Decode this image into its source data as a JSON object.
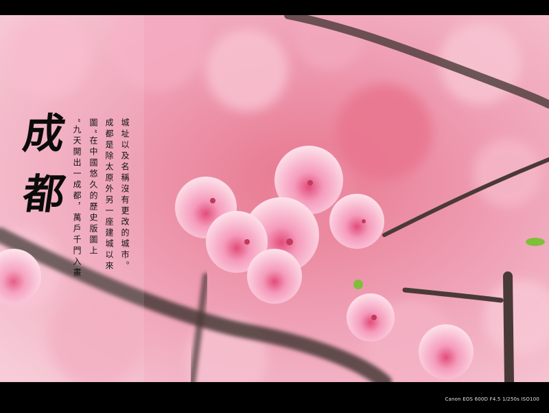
{
  "poem": {
    "title_char_1": "成",
    "title_char_2": "都",
    "lines": [
      "“九天開出一成都，萬戶千門入畫",
      "圖”在中國悠久的歷史版圖上",
      "成都是除太原外另一座建城以來",
      "城址以及名稱沒有更改的城市。"
    ]
  },
  "exif": "Canon EOS 600D F4.5 1/250s ISO100",
  "colors": {
    "background": "#000000",
    "blossom": "#f4a9c3",
    "branch": "#4a3a37"
  }
}
